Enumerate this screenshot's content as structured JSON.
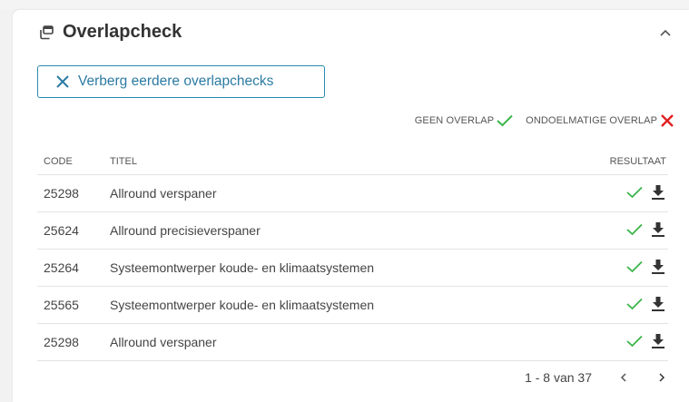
{
  "header": {
    "title": "Overlapcheck",
    "icon": "overlap-icon",
    "collapse_icon": "chevron-up-icon"
  },
  "hide_button": {
    "label": "Verberg eerdere overlapchecks",
    "icon": "close-icon"
  },
  "legend": {
    "no_overlap": "GEEN OVERLAP",
    "improper_overlap": "ONDOELMATIGE OVERLAP",
    "colors": {
      "check": "#3bb54a",
      "cross": "#e02020",
      "accent": "#2b8ab0"
    }
  },
  "table": {
    "columns": {
      "code": "CODE",
      "title": "TITEL",
      "result": "RESULTAAT"
    },
    "rows": [
      {
        "code": "25298",
        "title": "Allround verspaner"
      },
      {
        "code": "25624",
        "title": "Allround precisieverspaner"
      },
      {
        "code": "25264",
        "title": "Systeemontwerper koude- en klimaatsystemen"
      },
      {
        "code": "25565",
        "title": "Systeemontwerper koude- en klimaatsystemen"
      },
      {
        "code": "25298",
        "title": "Allround verspaner"
      }
    ]
  },
  "pagination": {
    "range": "1 - 8 van 37"
  }
}
